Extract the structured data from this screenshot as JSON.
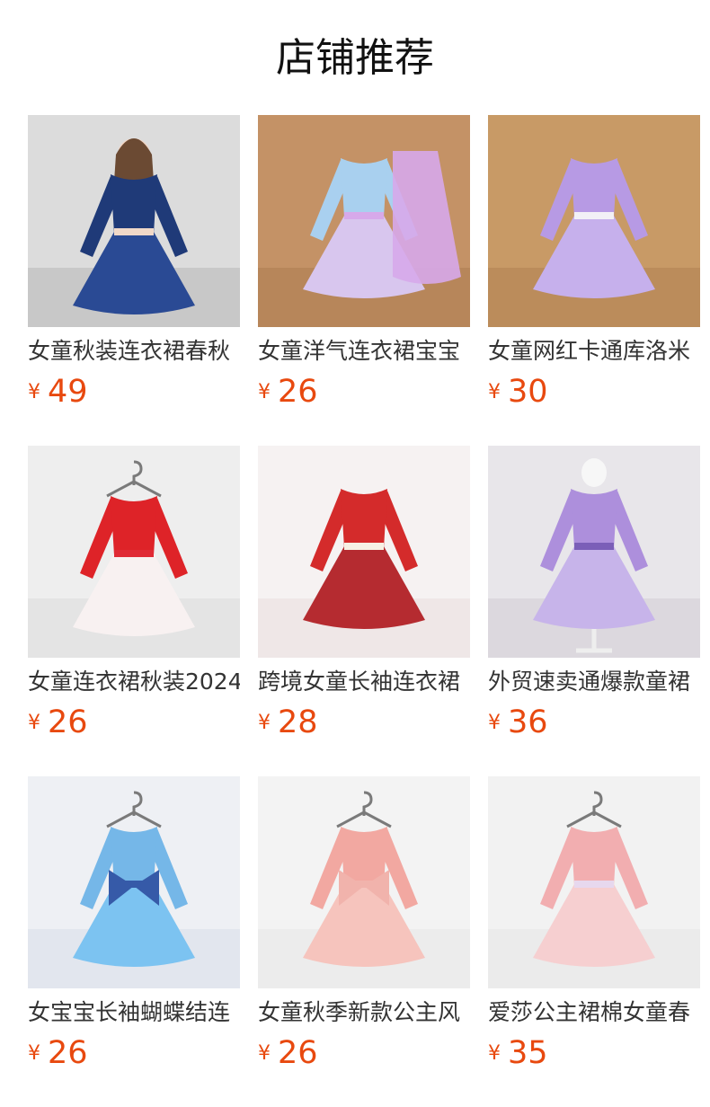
{
  "page_title": "店铺推荐",
  "currency_symbol": "¥",
  "price_color": "#e8490f",
  "products": [
    {
      "name": "女童秋装连衣裙春秋",
      "price": "49",
      "image": {
        "bg": "#dcdcdc",
        "floor": "#c8c8c8",
        "dress": "#1f3a78",
        "skirt": "#2a4a94",
        "accent": "#f0d8c8",
        "kind": "model"
      }
    },
    {
      "name": "女童洋气连衣裙宝宝",
      "price": "26",
      "image": {
        "bg": "#c49266",
        "floor": "#b7865a",
        "dress": "#a9d0ef",
        "skirt": "#d8c6ee",
        "accent": "#d7a9ea",
        "kind": "flat-pair"
      }
    },
    {
      "name": "女童网红卡通库洛米",
      "price": "30",
      "image": {
        "bg": "#c89a66",
        "floor": "#bb8c5b",
        "dress": "#b79ae4",
        "skirt": "#c6b0ec",
        "accent": "#f2f0f6",
        "kind": "flat"
      }
    },
    {
      "name": "女童连衣裙秋装2024",
      "price": "26",
      "image": {
        "bg": "#eeeeee",
        "floor": "#e4e4e4",
        "dress": "#de2328",
        "skirt": "#f8f1f1",
        "accent": "#e02a35",
        "kind": "hanger"
      }
    },
    {
      "name": "跨境女童长袖连衣裙",
      "price": "28",
      "image": {
        "bg": "#f6f2f2",
        "floor": "#efe7e7",
        "dress": "#d42b2b",
        "skirt": "#b52b30",
        "accent": "#f7f0e4",
        "kind": "flat-plaid"
      }
    },
    {
      "name": "外贸速卖通爆款童裙",
      "price": "36",
      "image": {
        "bg": "#e8e6ea",
        "floor": "#dcd8de",
        "dress": "#ad8fdc",
        "skirt": "#c7b4ea",
        "accent": "#7b5fb8",
        "kind": "mannequin"
      }
    },
    {
      "name": "女宝宝长袖蝴蝶结连",
      "price": "26",
      "image": {
        "bg": "#eef0f4",
        "floor": "#e2e6ee",
        "dress": "#75b7e8",
        "skirt": "#7cc3f1",
        "accent": "#365aa8",
        "kind": "hanger-blue"
      }
    },
    {
      "name": "女童秋季新款公主风",
      "price": "26",
      "image": {
        "bg": "#f3f3f3",
        "floor": "#ececec",
        "dress": "#f2a8a1",
        "skirt": "#f6c4bd",
        "accent": "#f1b3ac",
        "kind": "hanger-bow"
      }
    },
    {
      "name": "爱莎公主裙棉女童春",
      "price": "35",
      "image": {
        "bg": "#f2f2f2",
        "floor": "#ebebeb",
        "dress": "#f2aeb0",
        "skirt": "#f6cfd0",
        "accent": "#e7d8ee",
        "kind": "hanger-elsa"
      }
    }
  ]
}
